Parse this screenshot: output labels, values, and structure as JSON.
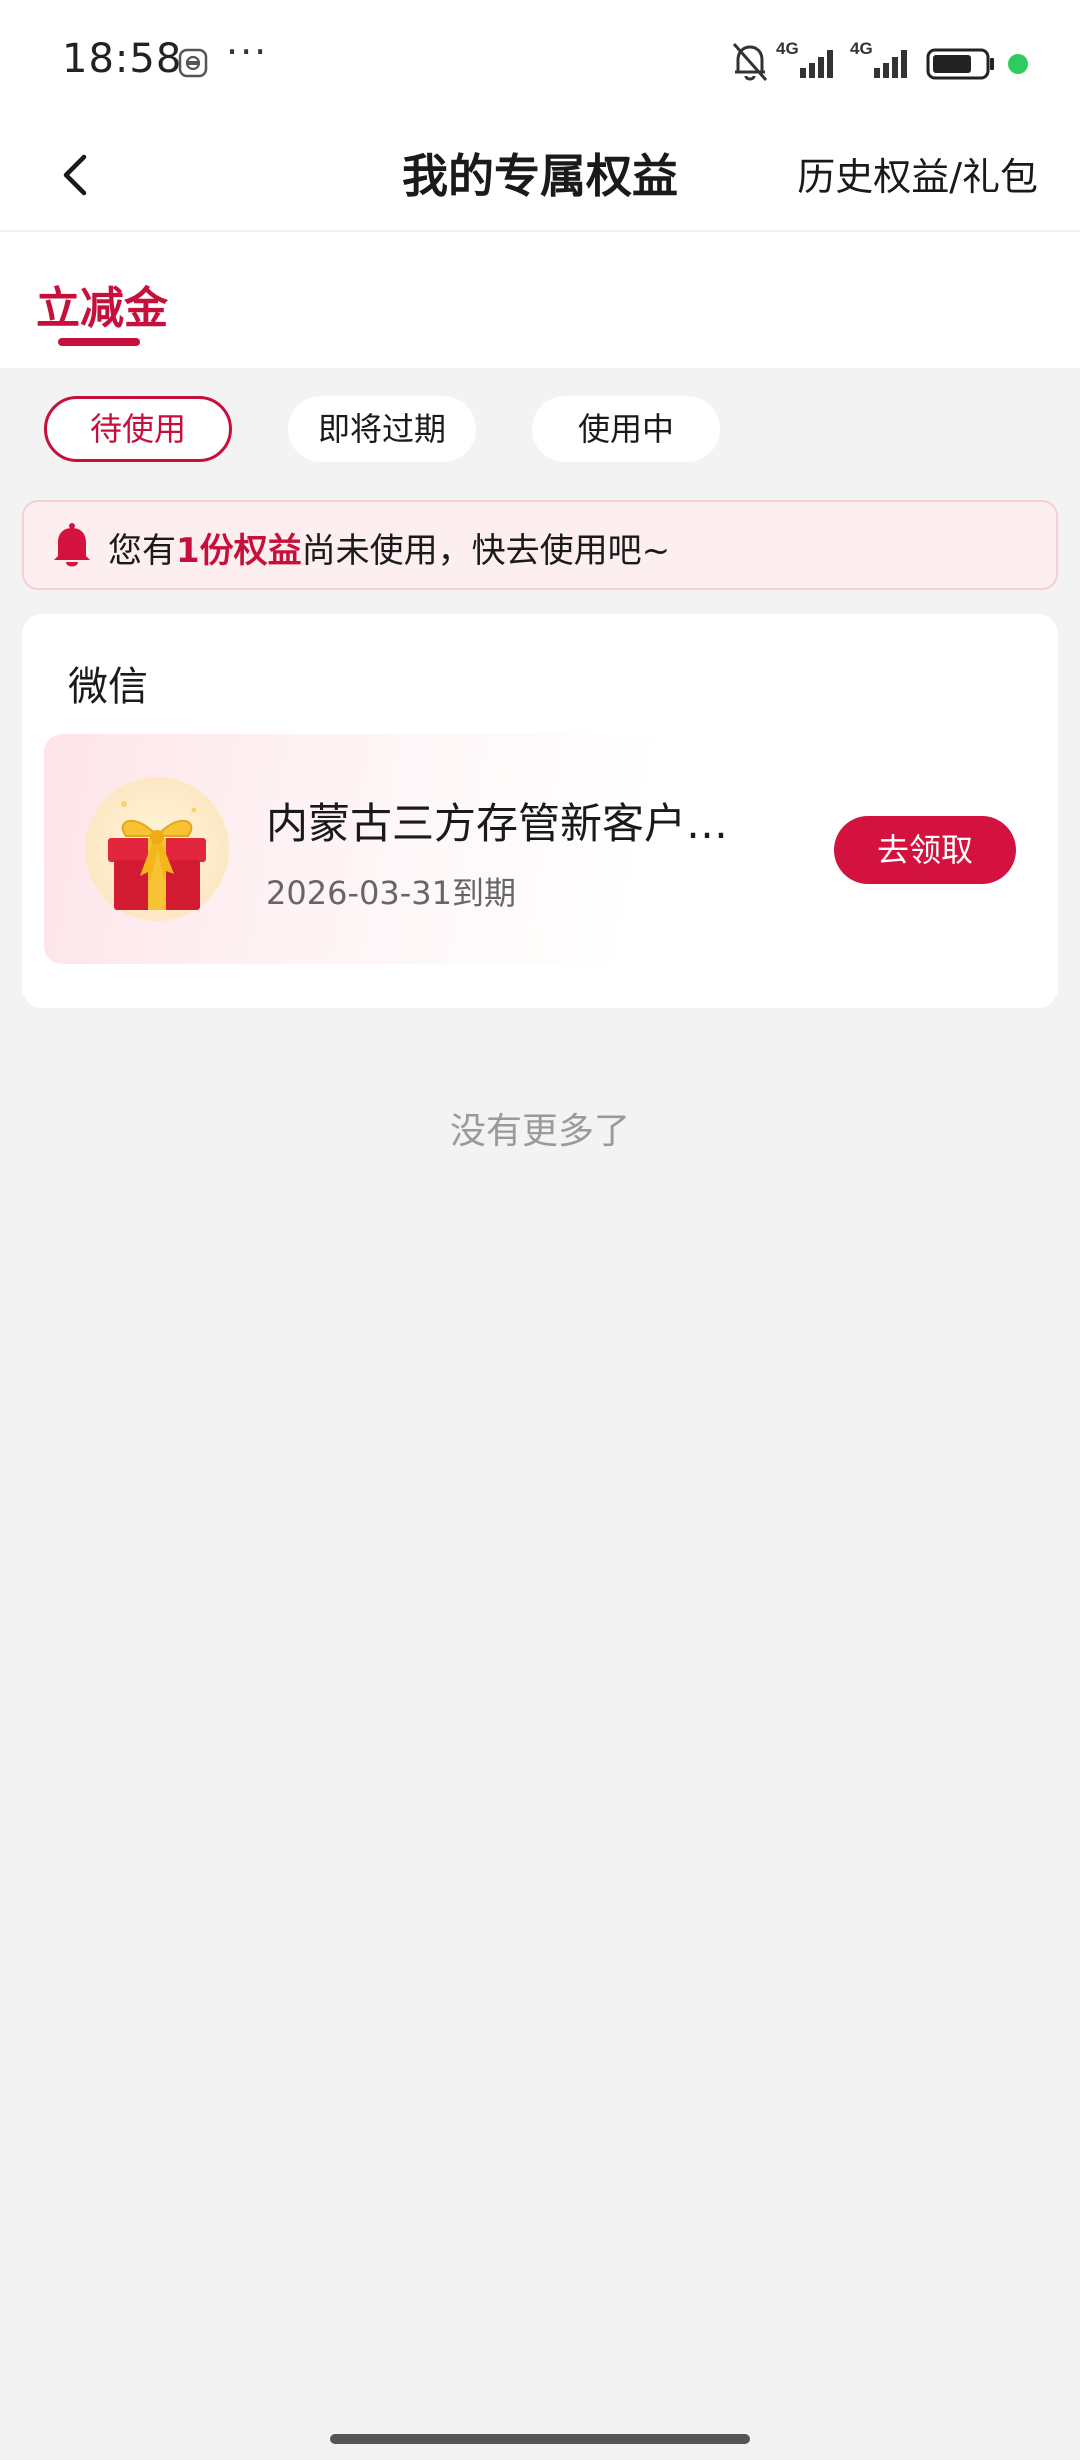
{
  "status_bar": {
    "time": "18:58",
    "more": "···",
    "network1": "4G",
    "network2": "4G",
    "icons": [
      "app-notification-icon",
      "mute-icon",
      "signal-icon",
      "signal-icon",
      "battery-icon"
    ],
    "active_dot_color": "#2ecc5f"
  },
  "nav": {
    "back_icon": "chevron-left-icon",
    "title": "我的专属权益",
    "history_link": "历史权益/礼包"
  },
  "category_tab": {
    "label": "立减金",
    "accent_color": "#c6103b"
  },
  "filters": [
    {
      "label": "待使用",
      "active": true
    },
    {
      "label": "即将过期",
      "active": false
    },
    {
      "label": "使用中",
      "active": false
    }
  ],
  "notice": {
    "icon": "bell-icon",
    "prefix": "您有",
    "highlight": "1份权益",
    "suffix": "尚未使用，快去使用吧~"
  },
  "groups": [
    {
      "title": "微信",
      "items": [
        {
          "icon": "gift-icon",
          "name": "内蒙古三方存管新客户立减金",
          "expire": "2026-03-31到期",
          "action": "去领取"
        }
      ]
    }
  ],
  "footer": {
    "no_more": "没有更多了"
  }
}
